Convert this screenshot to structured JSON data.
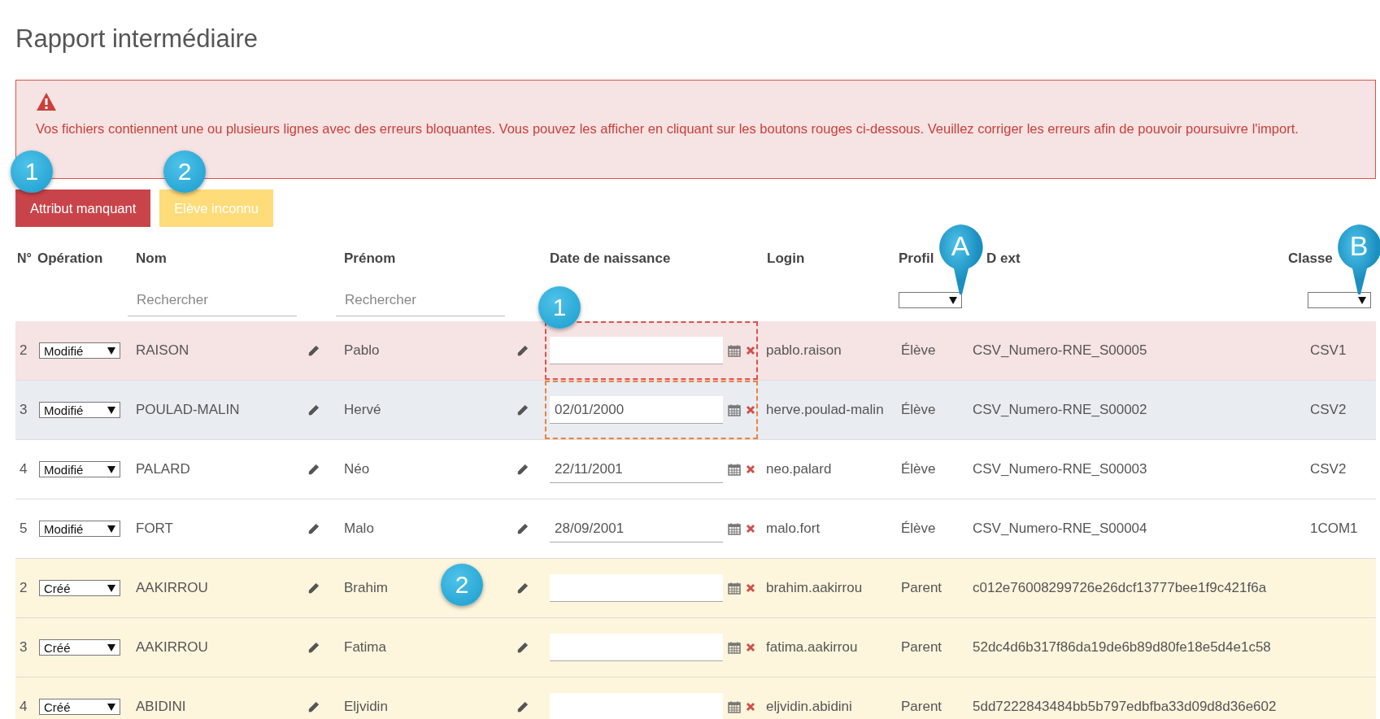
{
  "title": "Rapport intermédiaire",
  "alert": {
    "message": "Vos fichiers contiennent une ou plusieurs lignes avec des erreurs bloquantes. Vous pouvez les afficher en cliquant sur les boutons rouges ci-dessous. Veuillez corriger les erreurs afin de pouvoir poursuivre l'import."
  },
  "filter_buttons": [
    {
      "label": "Attribut manquant",
      "kind": "danger"
    },
    {
      "label": "Elève inconnu",
      "kind": "warning"
    }
  ],
  "table": {
    "columns": [
      "N°",
      "Opération",
      "Nom",
      "Prénom",
      "Date de naissance",
      "Login",
      "Profil",
      "D ext",
      "Classe"
    ],
    "filters": {
      "nom_placeholder": "Rechercher",
      "prenom_placeholder": "Rechercher"
    },
    "rows": [
      {
        "num": "2",
        "operation": "Modifié",
        "nom": "RAISON",
        "prenom": "Pablo",
        "date": "",
        "login": "pablo.raison",
        "profil": "Élève",
        "id_ext": "CSV_Numero-RNE_S00005",
        "classes": "CSV1",
        "error": true,
        "selected": false,
        "created": false,
        "date_flag": {
          "color": "#d9534f"
        }
      },
      {
        "num": "3",
        "operation": "Modifié",
        "nom": "POULAD-MALIN",
        "prenom": "Hervé",
        "date": "02/01/2000",
        "login": "herve.poulad-malin",
        "profil": "Élève",
        "id_ext": "CSV_Numero-RNE_S00002",
        "classes": "CSV2",
        "error": false,
        "selected": true,
        "created": false,
        "date_flag": {
          "color": "#f0803c"
        }
      },
      {
        "num": "4",
        "operation": "Modifié",
        "nom": "PALARD",
        "prenom": "Néo",
        "date": "22/11/2001",
        "login": "neo.palard",
        "profil": "Élève",
        "id_ext": "CSV_Numero-RNE_S00003",
        "classes": "CSV2",
        "error": false,
        "selected": false,
        "created": false
      },
      {
        "num": "5",
        "operation": "Modifié",
        "nom": "FORT",
        "prenom": "Malo",
        "date": "28/09/2001",
        "login": "malo.fort",
        "profil": "Élève",
        "id_ext": "CSV_Numero-RNE_S00004",
        "classes": "1COM1",
        "error": false,
        "selected": false,
        "created": false
      },
      {
        "num": "2",
        "operation": "Créé",
        "nom": "AAKIRROU",
        "prenom": "Brahim",
        "date": "",
        "login": "brahim.aakirrou",
        "profil": "Parent",
        "id_ext": "c012e76008299726e26dcf13777bee1f9c421f6a",
        "error": false,
        "selected": false,
        "created": true
      },
      {
        "num": "3",
        "operation": "Créé",
        "nom": "AAKIRROU",
        "prenom": "Fatima",
        "date": "",
        "login": "fatima.aakirrou",
        "profil": "Parent",
        "id_ext": "52dc4d6b317f86da19de6b89d80fe18e5d4e1c58",
        "error": false,
        "selected": false,
        "created": true
      },
      {
        "num": "4",
        "operation": "Créé",
        "nom": "ABIDINI",
        "prenom": "Eljvidin",
        "date": "",
        "login": "eljvidin.abidini",
        "profil": "Parent",
        "id_ext": "5dd7222843484bb5b797edbfba33d09d8d36e602",
        "error": false,
        "selected": false,
        "created": true
      }
    ]
  },
  "annotations": [
    {
      "label": "1",
      "kind": "circle"
    },
    {
      "label": "2",
      "kind": "circle"
    },
    {
      "label": "1",
      "kind": "circle"
    },
    {
      "label": "2",
      "kind": "circle"
    },
    {
      "label": "A",
      "kind": "pin"
    },
    {
      "label": "B",
      "kind": "pin"
    }
  ]
}
